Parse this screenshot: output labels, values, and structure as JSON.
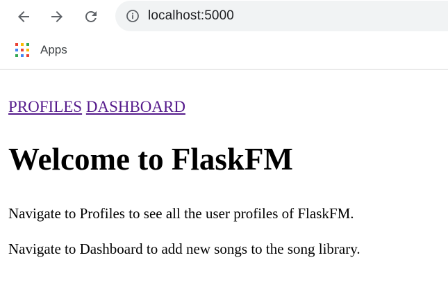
{
  "browser": {
    "back_icon": "arrow-left-icon",
    "forward_icon": "arrow-right-icon",
    "reload_icon": "reload-icon",
    "site_info_icon": "info-icon",
    "url": "localhost:5000",
    "bookmarks": {
      "apps_icon": "apps-grid-icon",
      "apps_label": "Apps"
    }
  },
  "page": {
    "nav_links": [
      {
        "label": "PROFILES"
      },
      {
        "label": "DASHBOARD"
      }
    ],
    "title": "Welcome to FlaskFM",
    "paragraphs": [
      "Navigate to Profiles to see all the user profiles of FlaskFM.",
      "Navigate to Dashboard to add new songs to the song library."
    ]
  },
  "colors": {
    "visited_link": "#551a8b",
    "omnibox_bg": "#f1f3f4",
    "toolbar_icon": "#5f6368"
  }
}
